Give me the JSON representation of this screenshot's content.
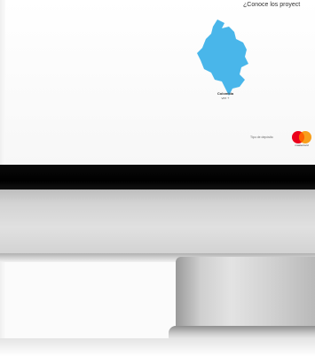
{
  "screen": {
    "title": "¿Conoce los proyect",
    "map": {
      "region_label": "Colombia",
      "region_sub": "ver +",
      "fill_color": "#49b6ea"
    },
    "payment": {
      "text": "Tipo de depósito",
      "brand": "mastercard",
      "brand_colors": {
        "red": "#eb001b",
        "yellow": "#f79e1b",
        "orange": "#ff5f00"
      }
    }
  },
  "device": {
    "icon": "monitor-icon"
  }
}
